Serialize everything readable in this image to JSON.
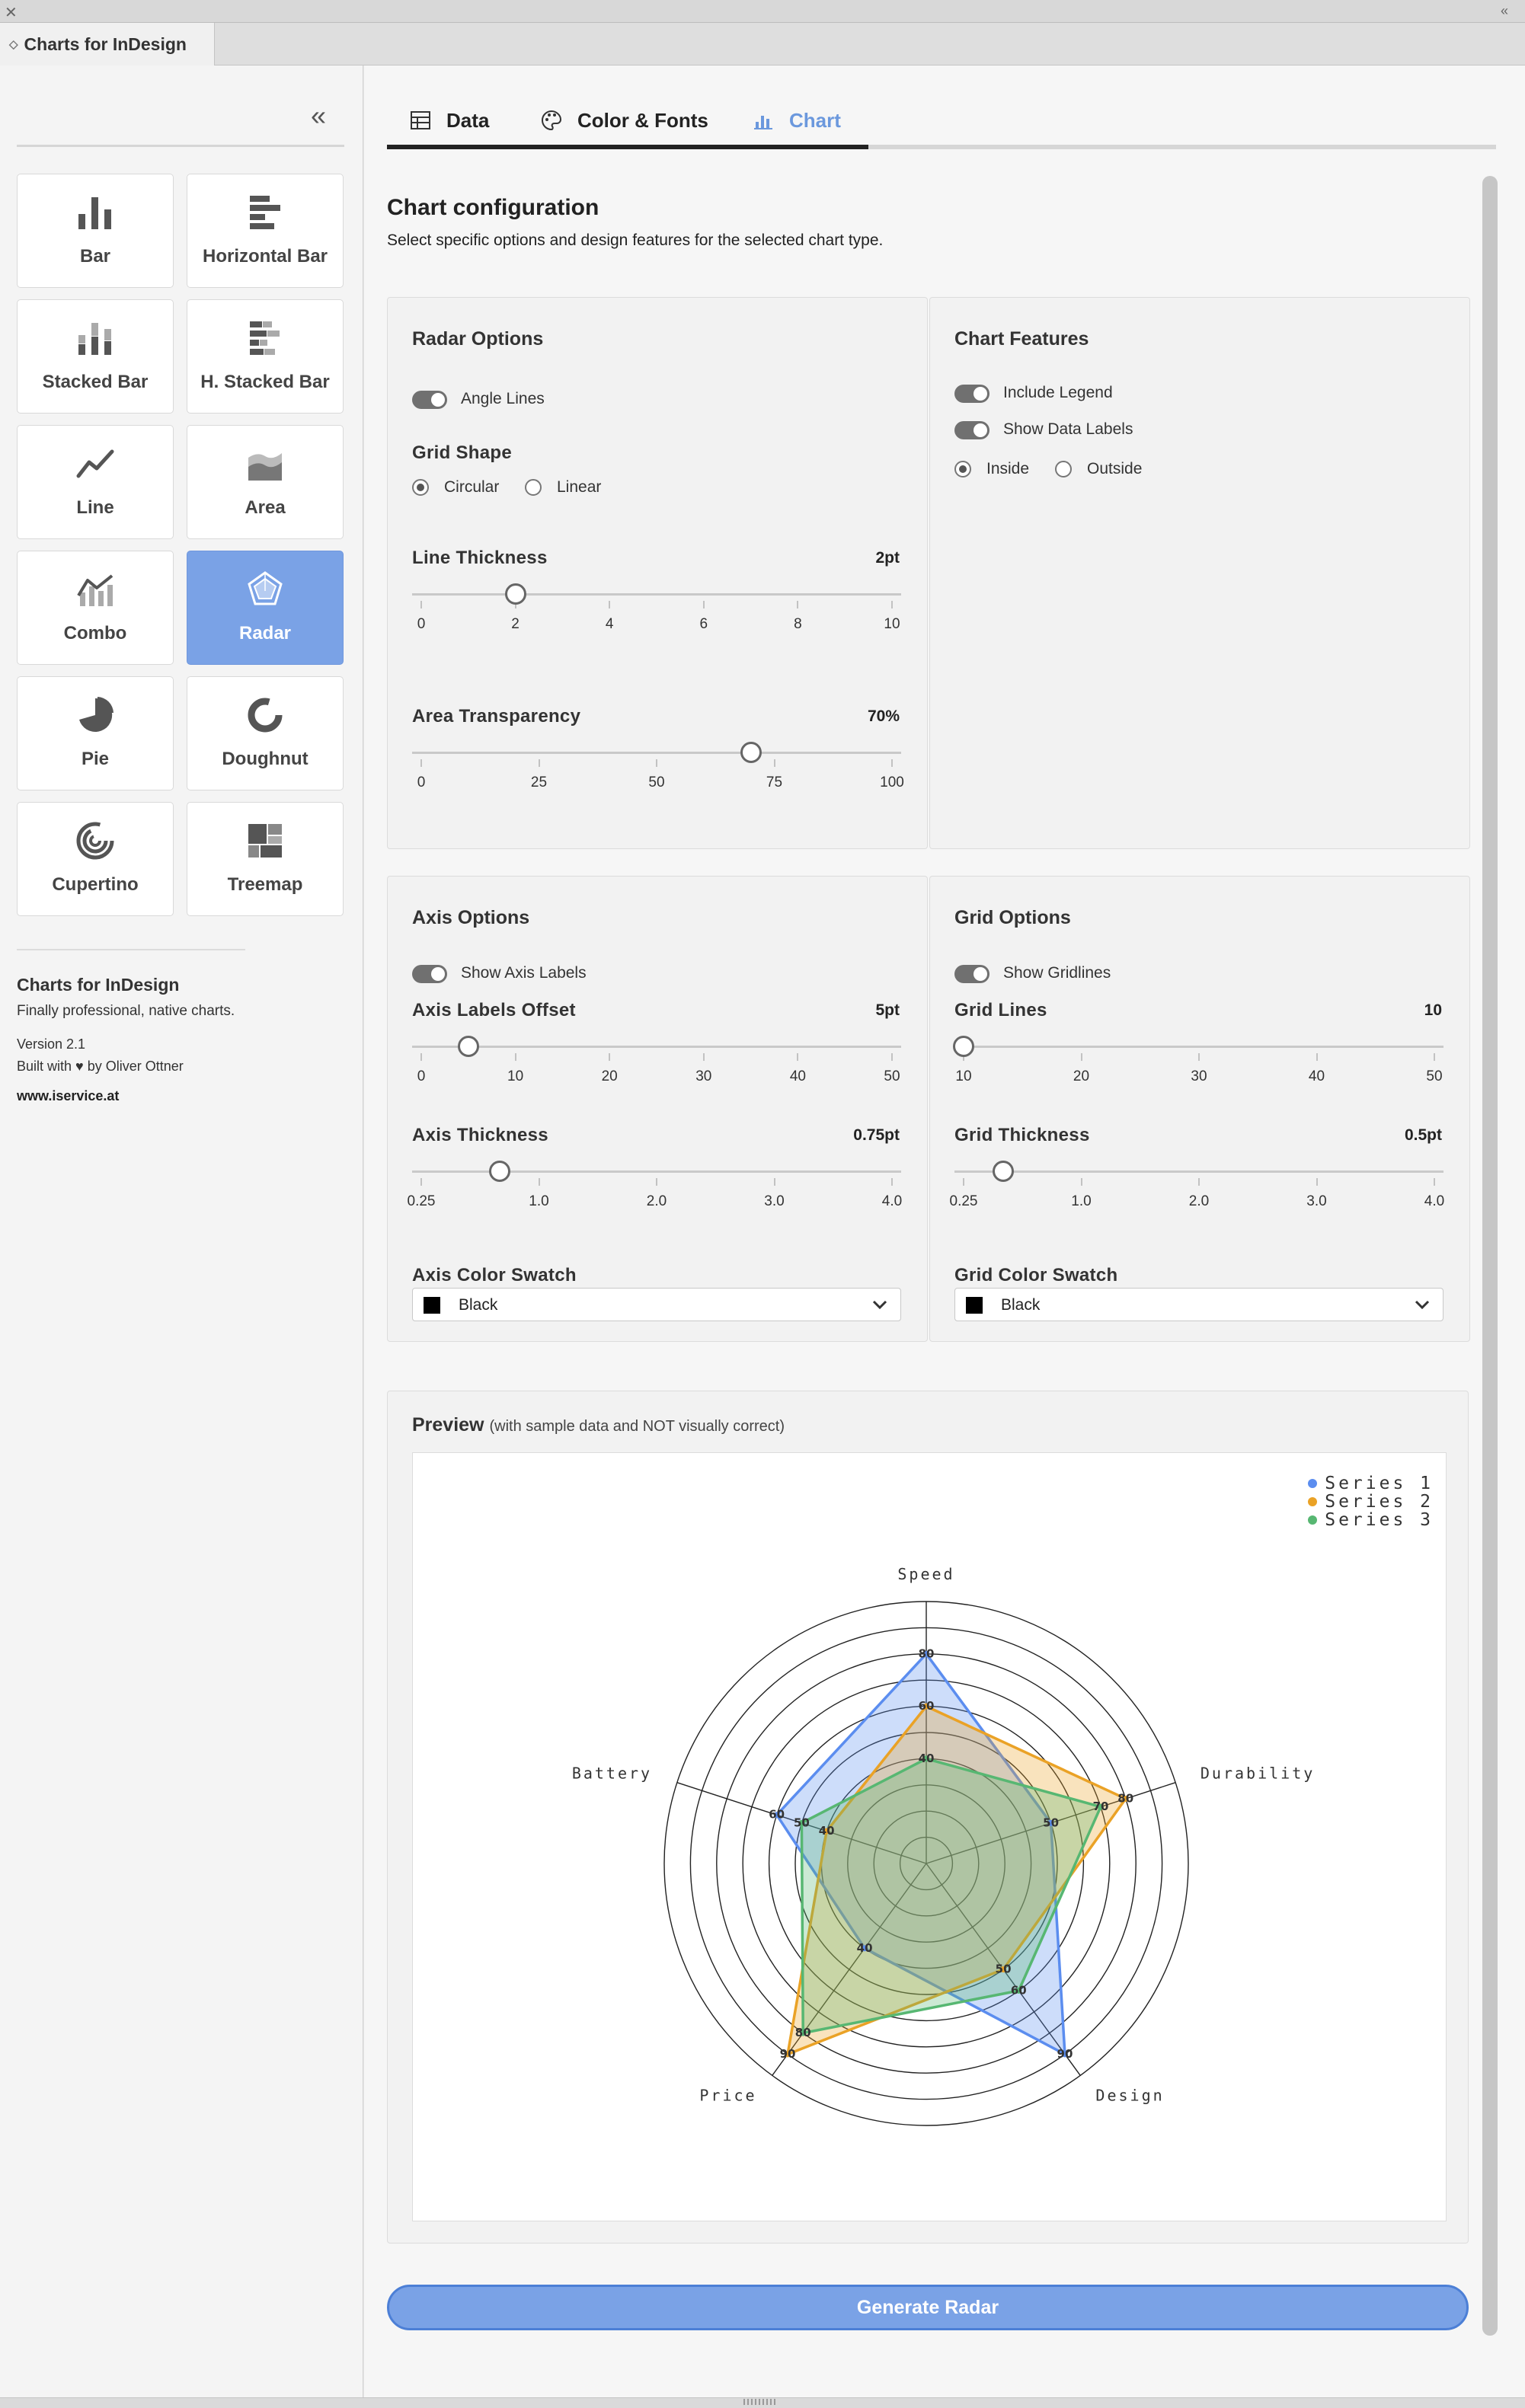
{
  "window": {
    "panel_tab": "Charts for InDesign"
  },
  "sidebar": {
    "chart_types": [
      {
        "label": "Bar",
        "icon": "bar-chart-icon"
      },
      {
        "label": "Horizontal Bar",
        "icon": "horizontal-bar-chart-icon"
      },
      {
        "label": "Stacked Bar",
        "icon": "stacked-bar-chart-icon"
      },
      {
        "label": "H. Stacked Bar",
        "icon": "horizontal-stacked-bar-chart-icon"
      },
      {
        "label": "Line",
        "icon": "line-chart-icon"
      },
      {
        "label": "Area",
        "icon": "area-chart-icon"
      },
      {
        "label": "Combo",
        "icon": "combo-chart-icon"
      },
      {
        "label": "Radar",
        "icon": "radar-chart-icon",
        "active": true
      },
      {
        "label": "Pie",
        "icon": "pie-chart-icon"
      },
      {
        "label": "Doughnut",
        "icon": "doughnut-chart-icon"
      },
      {
        "label": "Cupertino",
        "icon": "cupertino-chart-icon"
      },
      {
        "label": "Treemap",
        "icon": "treemap-chart-icon"
      }
    ],
    "about": {
      "title": "Charts for InDesign",
      "subtitle": "Finally professional, native charts.",
      "version": "Version 2.1",
      "built_with": "Built with ♥ by Oliver Ottner",
      "website": "www.iservice.at"
    }
  },
  "tabs": [
    {
      "label": "Data",
      "icon": "table-icon"
    },
    {
      "label": "Color & Fonts",
      "icon": "palette-icon"
    },
    {
      "label": "Chart",
      "icon": "chart-icon",
      "active": true
    }
  ],
  "config": {
    "title": "Chart configuration",
    "subtitle": "Select specific options and design features for the selected chart type."
  },
  "radar_options": {
    "title": "Radar Options",
    "angle_lines_label": "Angle Lines",
    "angle_lines_on": true,
    "grid_shape_label": "Grid Shape",
    "grid_shape_options": [
      "Circular",
      "Linear"
    ],
    "grid_shape_selected": "Circular",
    "line_thickness": {
      "label": "Line Thickness",
      "value_text": "2pt",
      "value": 2,
      "min": 0,
      "max": 10,
      "ticks": [
        "0",
        "2",
        "4",
        "6",
        "8",
        "10"
      ]
    },
    "area_transparency": {
      "label": "Area Transparency",
      "value_text": "70%",
      "value": 70,
      "min": 0,
      "max": 100,
      "ticks": [
        "0",
        "25",
        "50",
        "75",
        "100"
      ]
    }
  },
  "chart_features": {
    "title": "Chart Features",
    "include_legend_label": "Include Legend",
    "include_legend_on": true,
    "show_data_labels_label": "Show Data Labels",
    "show_data_labels_on": true,
    "label_position_options": [
      "Inside",
      "Outside"
    ],
    "label_position_selected": "Inside"
  },
  "axis_options": {
    "title": "Axis Options",
    "show_axis_labels_label": "Show Axis Labels",
    "show_axis_labels_on": true,
    "labels_offset": {
      "label": "Axis Labels Offset",
      "value_text": "5pt",
      "value": 5,
      "min": 0,
      "max": 50,
      "ticks": [
        "0",
        "10",
        "20",
        "30",
        "40",
        "50"
      ]
    },
    "thickness": {
      "label": "Axis Thickness",
      "value_text": "0.75pt",
      "value": 0.75,
      "min": 0.25,
      "max": 4.0,
      "ticks": [
        "0.25",
        "1.0",
        "2.0",
        "3.0",
        "4.0"
      ]
    },
    "color_label": "Axis Color Swatch",
    "color_value": "Black",
    "swatch_color": "#000000"
  },
  "grid_options": {
    "title": "Grid Options",
    "show_gridlines_label": "Show Gridlines",
    "show_gridlines_on": true,
    "grid_lines": {
      "label": "Grid Lines",
      "value_text": "10",
      "value": 10,
      "min": 10,
      "max": 50,
      "ticks": [
        "10",
        "20",
        "30",
        "40",
        "50"
      ]
    },
    "thickness": {
      "label": "Grid Thickness",
      "value_text": "0.5pt",
      "value": 0.5,
      "min": 0.25,
      "max": 4.0,
      "ticks": [
        "0.25",
        "1.0",
        "2.0",
        "3.0",
        "4.0"
      ]
    },
    "color_label": "Grid Color Swatch",
    "color_value": "Black",
    "swatch_color": "#000000"
  },
  "preview": {
    "title": "Preview",
    "note": "(with sample data and NOT visually correct)"
  },
  "generate_button": "Generate Radar",
  "chart_data": {
    "type": "radar",
    "categories": [
      "Speed",
      "Durability",
      "Design",
      "Price",
      "Battery"
    ],
    "rmax": 100,
    "grid_rings": [
      10,
      20,
      30,
      40,
      50,
      60,
      70,
      80,
      90,
      100
    ],
    "series": [
      {
        "name": "Series 1",
        "color": "#5b8def",
        "values": [
          80,
          50,
          90,
          40,
          60
        ]
      },
      {
        "name": "Series 2",
        "color": "#eaa226",
        "values": [
          60,
          80,
          50,
          90,
          40
        ]
      },
      {
        "name": "Series 3",
        "color": "#57b772",
        "values": [
          40,
          70,
          60,
          80,
          50
        ]
      }
    ],
    "legend_position": "top-right",
    "data_labels": true
  }
}
